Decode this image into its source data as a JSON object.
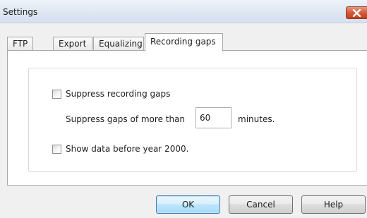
{
  "window": {
    "title": "Settings"
  },
  "tabs": [
    {
      "label": "FTP"
    },
    {
      "label": "Export"
    },
    {
      "label": "Equalizing"
    },
    {
      "label": "Recording gaps"
    }
  ],
  "active_tab": "Recording gaps",
  "recording_gaps": {
    "suppress_label": "Suppress recording gaps",
    "suppress_checked": false,
    "gaps_prefix": "Suppress gaps of more than",
    "gaps_value": "60",
    "gaps_suffix": "minutes.",
    "show_data_label": "Show data before year 2000.",
    "show_data_checked": false
  },
  "buttons": {
    "ok": "OK",
    "cancel": "Cancel",
    "help": "Help"
  },
  "colors": {
    "close_button": "#d4583b",
    "default_button_border": "#3c7fb1"
  },
  "icons": {
    "close": "close-icon",
    "checkbox": "checkbox-unchecked"
  }
}
